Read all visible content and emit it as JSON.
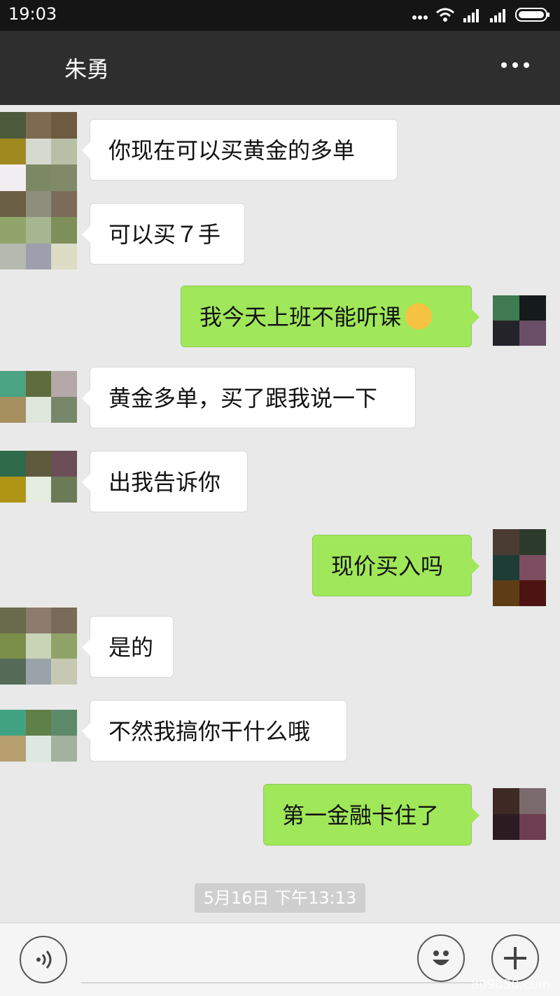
{
  "status_bar": {
    "time": "19:03",
    "icons": [
      "more-dots-icon",
      "wifi-icon",
      "signal-icon",
      "signal-icon",
      "battery-icon"
    ]
  },
  "header": {
    "contact_name": "朱勇",
    "more_icon": "more-options-icon"
  },
  "messages": [
    {
      "direction": "in",
      "text": "你现在可以买黄金的多单"
    },
    {
      "direction": "in",
      "text": "可以买７手"
    },
    {
      "direction": "out",
      "text": "我今天上班不能听课",
      "emoji": "hand-over-mouth-emoji"
    },
    {
      "direction": "in",
      "text": "黄金多单，买了跟我说一下"
    },
    {
      "direction": "in",
      "text": "出我告诉你"
    },
    {
      "direction": "out",
      "text": "现价买入吗"
    },
    {
      "direction": "in",
      "text": "是的"
    },
    {
      "direction": "in",
      "text": "不然我搞你干什么哦"
    },
    {
      "direction": "out",
      "text": "第一金融卡住了"
    }
  ],
  "timestamp": "5月16日 下午13:13",
  "input_bar": {
    "voice_icon": "voice-input-icon",
    "emoji_icon": "smiley-icon",
    "plus_icon": "plus-icon"
  },
  "watermark_text": "809030.com",
  "colors": {
    "outgoing_bubble": "#a0e75a",
    "incoming_bubble": "#ffffff",
    "header_bg": "#2e2e2e"
  }
}
